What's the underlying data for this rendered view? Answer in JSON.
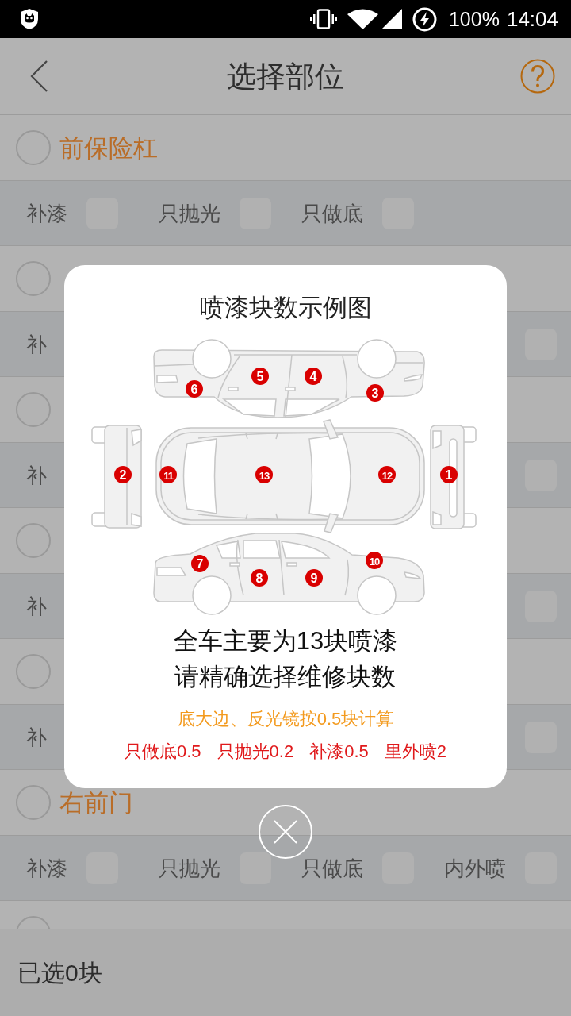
{
  "status_bar": {
    "battery": "100%",
    "time": "14:04"
  },
  "header": {
    "title": "选择部位"
  },
  "sections": [
    {
      "kind": "full",
      "title": "前保险杠",
      "selected": false,
      "options": [
        {
          "label": "补漆",
          "checked": false
        },
        {
          "label": "只抛光",
          "checked": false
        },
        {
          "label": "只做底",
          "checked": false
        }
      ]
    },
    {
      "kind": "covered",
      "selected": false,
      "first_option": "补",
      "last_checked": false
    },
    {
      "kind": "covered",
      "selected": false,
      "first_option": "补",
      "last_checked": false
    },
    {
      "kind": "covered",
      "selected": false,
      "first_option": "补",
      "last_checked": false
    },
    {
      "kind": "covered",
      "selected": false,
      "first_option": "补",
      "last_checked": false
    },
    {
      "kind": "full",
      "title": "右前门",
      "selected": false,
      "options": [
        {
          "label": "补漆",
          "checked": false
        },
        {
          "label": "只抛光",
          "checked": false
        },
        {
          "label": "只做底",
          "checked": false
        },
        {
          "label": "内外喷",
          "checked": false
        }
      ]
    },
    {
      "kind": "cut",
      "selected": false
    }
  ],
  "dialog": {
    "title": "喷漆块数示例图",
    "diagram": {
      "views": [
        {
          "kind": "side_top",
          "markers": [
            "6",
            "5",
            "4",
            "3"
          ]
        },
        {
          "kind": "front",
          "markers": [
            "2"
          ]
        },
        {
          "kind": "roof",
          "markers": [
            "11",
            "13",
            "12"
          ]
        },
        {
          "kind": "rear",
          "markers": [
            "1"
          ]
        },
        {
          "kind": "side_bottom",
          "markers": [
            "7",
            "8",
            "9",
            "10"
          ]
        }
      ]
    },
    "message_lines": [
      "全车主要为13块喷漆",
      "请精确选择维修块数"
    ],
    "note": "底大边、反光镜按0.5块计算",
    "rates": [
      "只做底0.5",
      "只抛光0.2",
      "补漆0.5",
      "里外喷2"
    ]
  },
  "footer": {
    "selected_count": "已选0块"
  }
}
